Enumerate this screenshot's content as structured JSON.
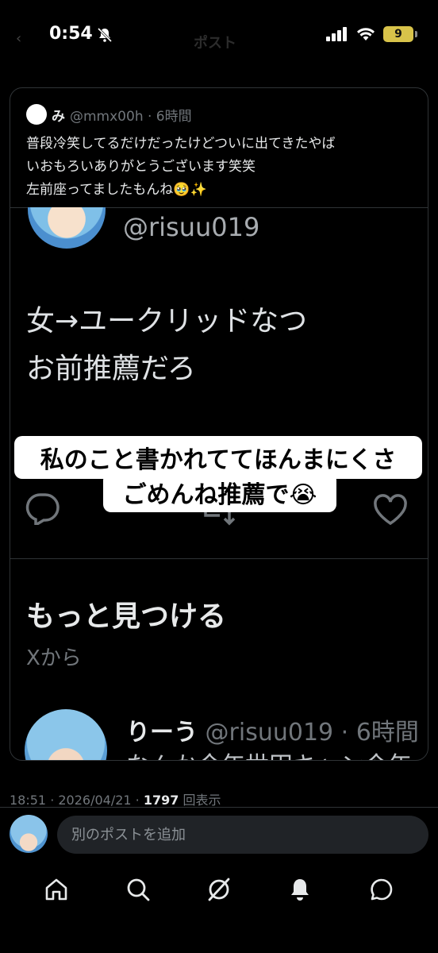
{
  "status_bar": {
    "time": "0:54",
    "battery": "9"
  },
  "quote": {
    "name": "み",
    "handle_time": "@mmx00h · 6時間",
    "text": "普段冷笑してるだけだったけどついに出てきたやば\nいおもろいありがとうございます笑笑\n左前座ってましたもんね🥹✨"
  },
  "embedded": {
    "handle": "@risuu019",
    "body": "女→ユークリッドなつ\nお前推薦だろ",
    "section_title": "もっと見つける",
    "section_sub": "Xから",
    "post_name": "りーう",
    "post_handle_time": " @risuu019 · 6時間",
    "post_cut": "なんか今年世田キャン今年"
  },
  "caption": {
    "line1": "私のこと書かれててほんまにくさ",
    "line2": "ごめんね推薦で😭"
  },
  "meta": {
    "timestamp": "18:51 · 2026/04/21 · ",
    "views": "1797",
    "views_label": " 回表示"
  },
  "reply": {
    "placeholder": "別のポストを追加"
  },
  "nav": [
    "home-icon",
    "search-icon",
    "grok-icon",
    "notifications-icon",
    "messages-icon"
  ]
}
